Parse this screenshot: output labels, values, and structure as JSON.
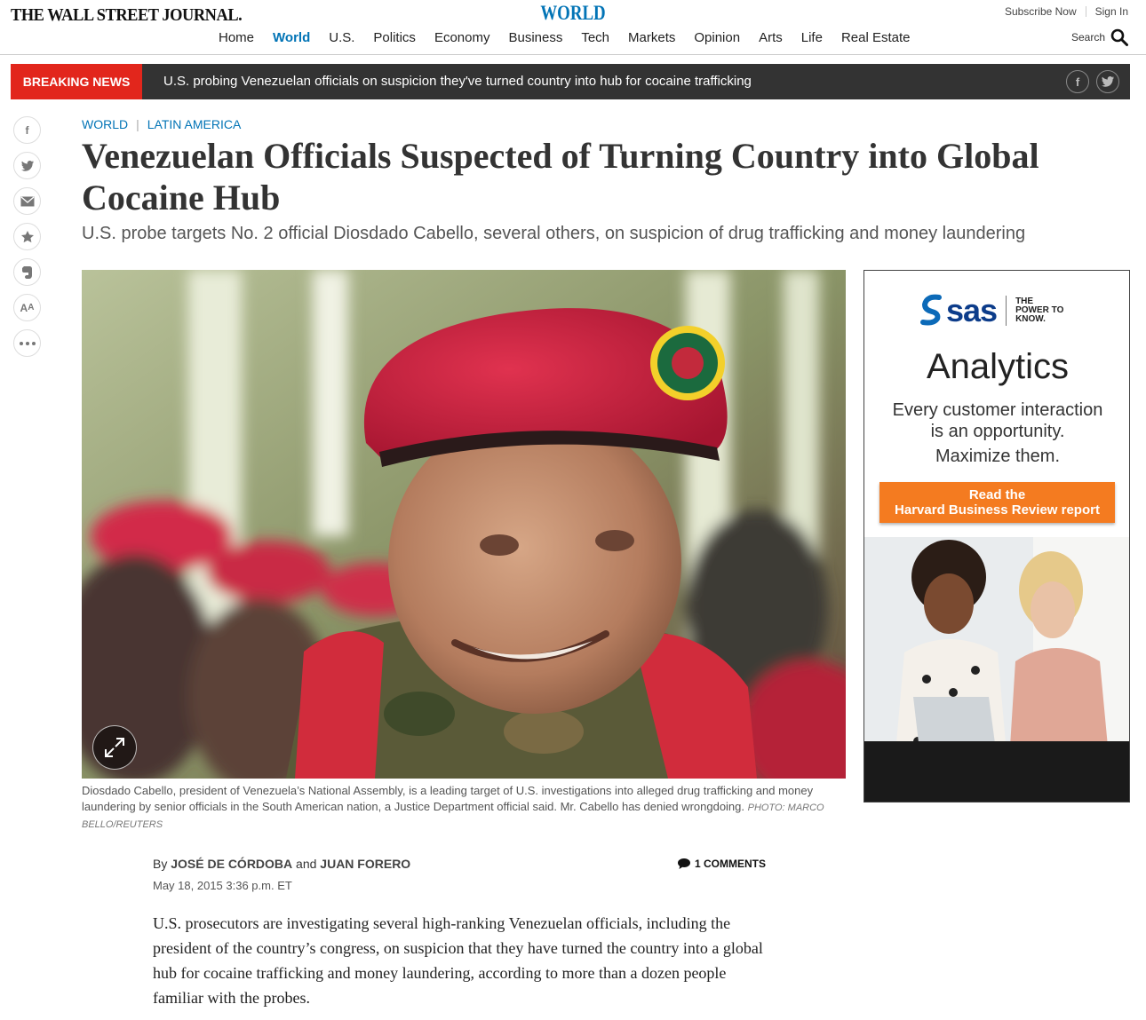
{
  "header": {
    "logo": "THE WALL STREET JOURNAL.",
    "section": "WORLD",
    "subscribe": "Subscribe Now",
    "signin": "Sign In",
    "search_label": "Search",
    "nav": [
      "Home",
      "World",
      "U.S.",
      "Politics",
      "Economy",
      "Business",
      "Tech",
      "Markets",
      "Opinion",
      "Arts",
      "Life",
      "Real Estate"
    ],
    "active_nav": "World"
  },
  "breaking": {
    "label": "BREAKING NEWS",
    "text": "U.S. probing Venezuelan officials on suspicion they've turned country into hub for cocaine trafficking",
    "share": [
      "facebook-icon",
      "twitter-icon"
    ]
  },
  "rail": [
    "facebook-icon",
    "twitter-icon",
    "email-icon",
    "star-icon",
    "evernote-icon",
    "text-size-icon",
    "more-icon"
  ],
  "article": {
    "kicker_section": "WORLD",
    "kicker_subsection": "LATIN AMERICA",
    "headline": "Venezuelan Officials Suspected of Turning Country into Global Cocaine Hub",
    "dek": "U.S. probe targets No. 2 official Diosdado Cabello, several others, on suspicion of drug trafficking and money laundering",
    "caption": "Diosdado Cabello, president of Venezuela’s National Assembly, is a leading target of U.S. investigations into alleged drug trafficking and money laundering by senior officials in the South American nation, a Justice Department official said. Mr. Cabello has denied wrongdoing.",
    "photo_credit": "PHOTO: MARCO BELLO/REUTERS",
    "byline_prefix": "By",
    "author1": "JOSÉ DE CÓRDOBA",
    "byline_and": "and",
    "author2": "JUAN FORERO",
    "date": "May 18, 2015 3:36 p.m. ET",
    "comments": "1 COMMENTS",
    "body": "U.S. prosecutors are investigating several high-ranking Venezuelan officials, including the president of the country’s congress, on suspicion that they have turned the country into a global hub for cocaine trafficking and money laundering, according to more than a dozen people familiar with the probes."
  },
  "ad": {
    "brand": "sas",
    "tagline": "THE POWER TO KNOW.",
    "title": "Analytics",
    "copy": "Every customer interaction is an opportunity.",
    "copy2": "Maximize them.",
    "cta_line1": "Read the",
    "cta_line2": "Harvard Business Review report"
  },
  "colors": {
    "accent": "#0274b6",
    "breaking_red": "#e2261c",
    "ad_orange": "#f47b20",
    "beret_red": "#c8203b"
  }
}
